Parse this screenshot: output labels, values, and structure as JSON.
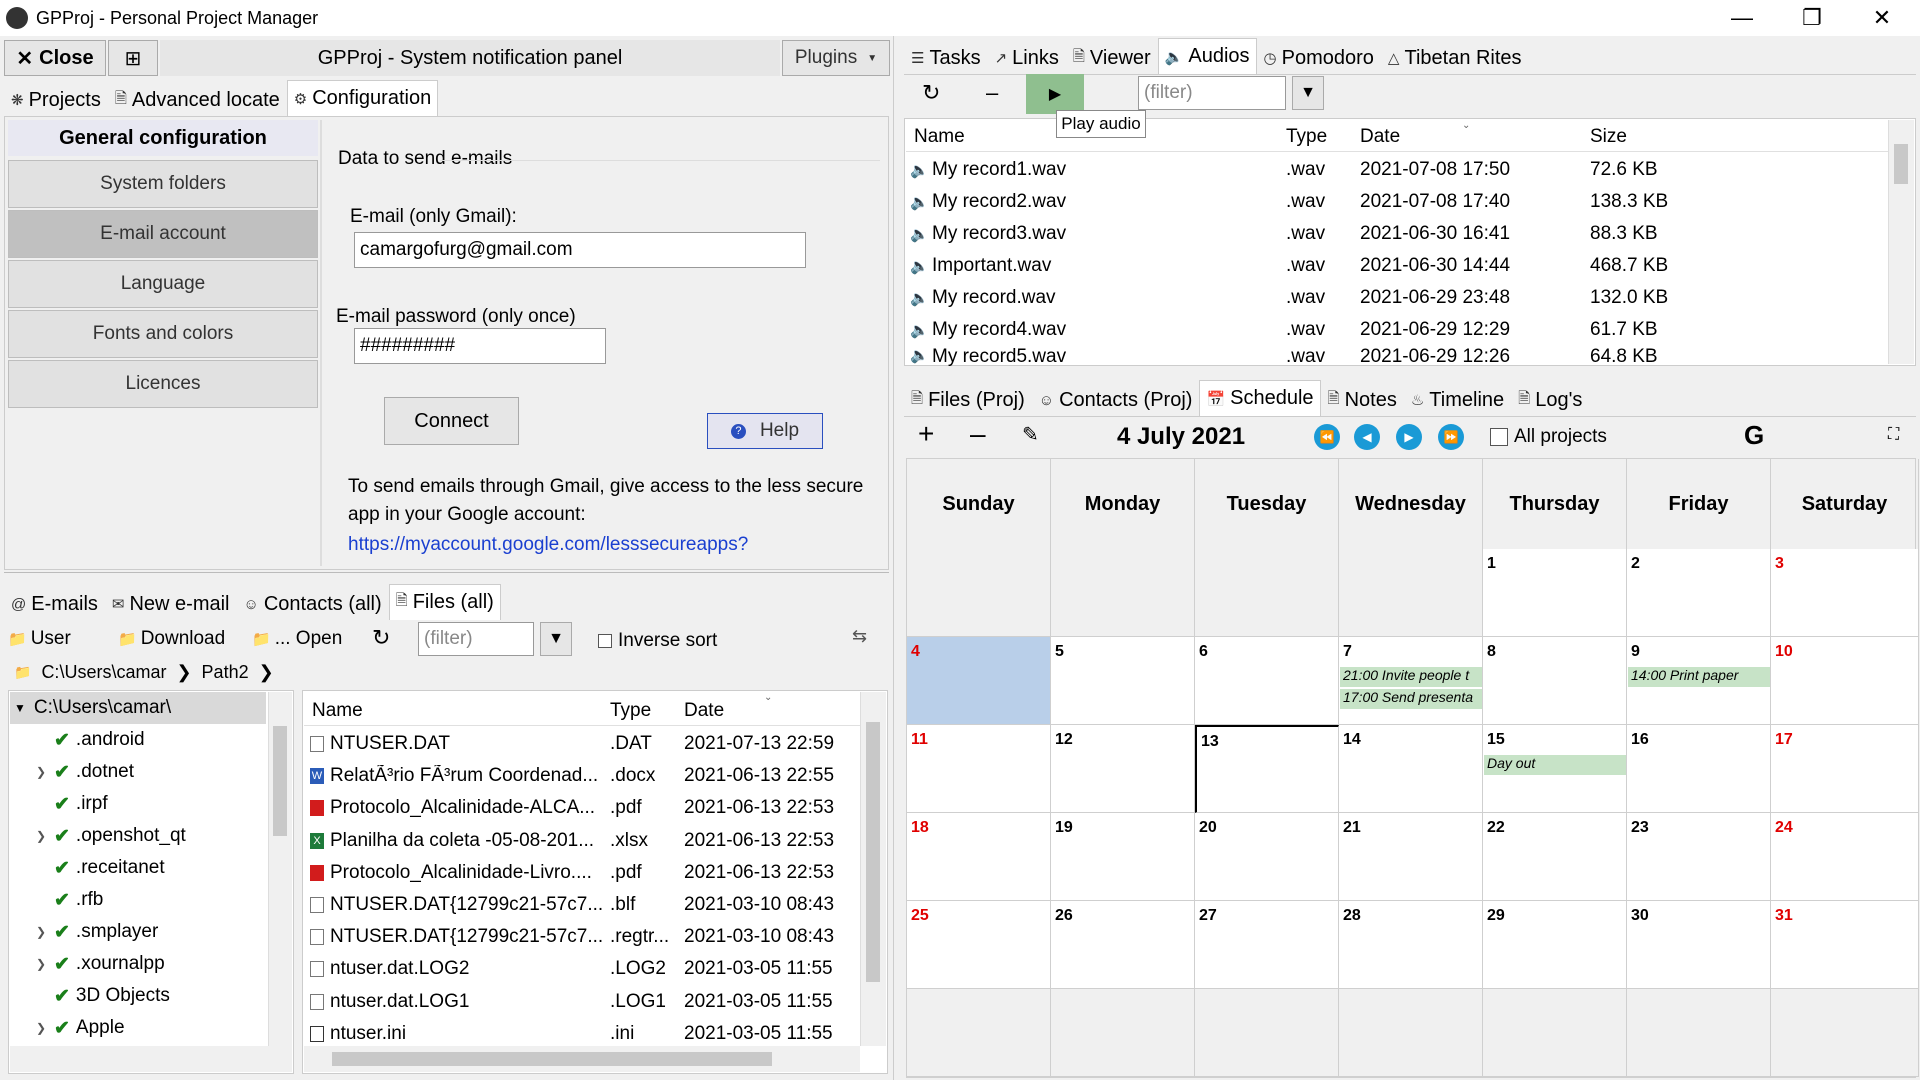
{
  "window": {
    "title": "GPProj - Personal Project Manager"
  },
  "left_top": {
    "close_label": "Close",
    "panel_title": "GPProj - System notification panel",
    "plugins_label": "Plugins",
    "tabs": [
      "Projects",
      "Advanced locate",
      "Configuration"
    ],
    "config_heading": "General configuration",
    "config_items": [
      "System folders",
      "E-mail account",
      "Language",
      "Fonts and colors",
      "Licences"
    ],
    "email": {
      "group_label": "Data to send e-mails",
      "email_label": "E-mail (only Gmail):",
      "email_value": "camargofurg@gmail.com",
      "password_label": "E-mail password (only once)",
      "password_value": "#########",
      "connect_label": "Connect",
      "help_label": "Help",
      "info_line1": "To send emails through Gmail, give access to the less secure",
      "info_line2": "app in your Google account:",
      "link": "https://myaccount.google.com/lesssecureapps?"
    }
  },
  "left_bottom": {
    "tabs": [
      "E-mails",
      "New e-mail",
      "Contacts (all)",
      "Files (all)"
    ],
    "toolbar": {
      "user": "User",
      "download": "Download",
      "open": "... Open",
      "filter_placeholder": "(filter)",
      "inverse_sort": "Inverse sort"
    },
    "breadcrumb": [
      "C:\\Users\\camar",
      "Path2"
    ],
    "tree_root": "C:\\Users\\camar\\",
    "tree": [
      {
        "name": ".android",
        "expandable": false
      },
      {
        "name": ".dotnet",
        "expandable": true
      },
      {
        "name": ".irpf",
        "expandable": false
      },
      {
        "name": ".openshot_qt",
        "expandable": true
      },
      {
        "name": ".receitanet",
        "expandable": false
      },
      {
        "name": ".rfb",
        "expandable": false
      },
      {
        "name": ".smplayer",
        "expandable": true
      },
      {
        "name": ".xournalpp",
        "expandable": true
      },
      {
        "name": "3D Objects",
        "expandable": false
      },
      {
        "name": "Apple",
        "expandable": true
      }
    ],
    "columns": [
      "Name",
      "Type",
      "Date"
    ],
    "files": [
      {
        "name": "NTUSER.DAT",
        "type": ".DAT",
        "date": "2021-07-13 22:59",
        "icon": "file"
      },
      {
        "name": "RelatÃ³rio FÃ³rum Coordenad...",
        "type": ".docx",
        "date": "2021-06-13 22:55",
        "icon": "word"
      },
      {
        "name": "Protocolo_Alcalinidade-ALCA...",
        "type": ".pdf",
        "date": "2021-06-13 22:53",
        "icon": "pdf"
      },
      {
        "name": "Planilha da coleta -05-08-201...",
        "type": ".xlsx",
        "date": "2021-06-13 22:53",
        "icon": "excel"
      },
      {
        "name": "Protocolo_Alcalinidade-Livro....",
        "type": ".pdf",
        "date": "2021-06-13 22:53",
        "icon": "pdf"
      },
      {
        "name": "NTUSER.DAT{12799c21-57c7...",
        "type": ".blf",
        "date": "2021-03-10 08:43",
        "icon": "file"
      },
      {
        "name": "NTUSER.DAT{12799c21-57c7...",
        "type": ".regtr...",
        "date": "2021-03-10 08:43",
        "icon": "file"
      },
      {
        "name": "ntuser.dat.LOG2",
        "type": ".LOG2",
        "date": "2021-03-05 11:55",
        "icon": "file"
      },
      {
        "name": "ntuser.dat.LOG1",
        "type": ".LOG1",
        "date": "2021-03-05 11:55",
        "icon": "file"
      },
      {
        "name": "ntuser.ini",
        "type": ".ini",
        "date": "2021-03-05 11:55",
        "icon": "ini"
      }
    ]
  },
  "right_top": {
    "tabs": [
      "Tasks",
      "Links",
      "Viewer",
      "Audios",
      "Pomodoro",
      "Tibetan Rites"
    ],
    "filter_placeholder": "(filter)",
    "tooltip": "Play audio",
    "columns": [
      "Name",
      "Type",
      "Date",
      "Size"
    ],
    "audios": [
      {
        "name": "My record1.wav",
        "type": ".wav",
        "date": "2021-07-08 17:50",
        "size": "72.6 KB"
      },
      {
        "name": "My record2.wav",
        "type": ".wav",
        "date": "2021-07-08 17:40",
        "size": "138.3 KB"
      },
      {
        "name": "My record3.wav",
        "type": ".wav",
        "date": "2021-06-30 16:41",
        "size": "88.3 KB"
      },
      {
        "name": "Important.wav",
        "type": ".wav",
        "date": "2021-06-30 14:44",
        "size": "468.7 KB"
      },
      {
        "name": "My record.wav",
        "type": ".wav",
        "date": "2021-06-29 23:48",
        "size": "132.0 KB"
      },
      {
        "name": "My record4.wav",
        "type": ".wav",
        "date": "2021-06-29 12:29",
        "size": "61.7 KB"
      },
      {
        "name": "My record5.wav",
        "type": ".wav",
        "date": "2021-06-29 12:26",
        "size": "64.8 KB"
      }
    ]
  },
  "right_bottom": {
    "tabs": [
      "Files (Proj)",
      "Contacts (Proj)",
      "Schedule",
      "Notes",
      "Timeline",
      "Log's"
    ],
    "date_label": "4 July 2021",
    "all_projects": "All projects",
    "google_label": "G",
    "days": [
      "Sunday",
      "Monday",
      "Tuesday",
      "Wednesday",
      "Thursday",
      "Friday",
      "Saturday"
    ],
    "weeks": [
      [
        "",
        "",
        "",
        "",
        "1",
        "2",
        "3"
      ],
      [
        "4",
        "5",
        "6",
        "7",
        "8",
        "9",
        "10"
      ],
      [
        "11",
        "12",
        "13",
        "14",
        "15",
        "16",
        "17"
      ],
      [
        "18",
        "19",
        "20",
        "21",
        "22",
        "23",
        "24"
      ],
      [
        "25",
        "26",
        "27",
        "28",
        "29",
        "30",
        "31"
      ]
    ],
    "events": [
      {
        "week": 2,
        "day": 3,
        "slot": 0,
        "text": "21:00  Invite people t"
      },
      {
        "week": 2,
        "day": 3,
        "slot": 1,
        "text": "17:00  Send presenta"
      },
      {
        "week": 2,
        "day": 5,
        "slot": 0,
        "text": "14:00  Print paper"
      },
      {
        "week": 3,
        "day": 4,
        "slot": 0,
        "text": "Day out"
      }
    ]
  }
}
